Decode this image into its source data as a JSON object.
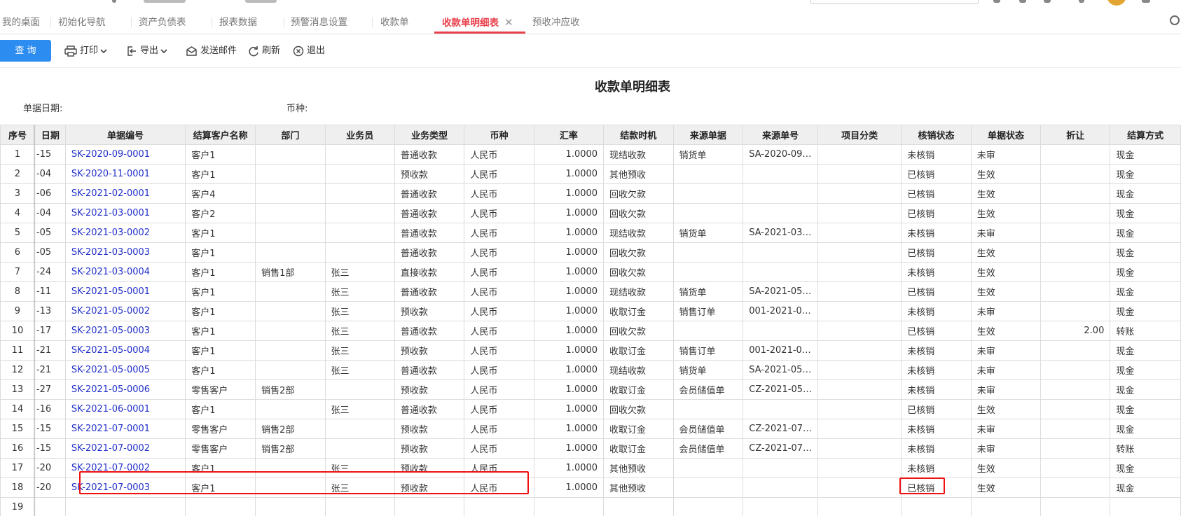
{
  "tabs": [
    {
      "label": "我的桌面",
      "active": false
    },
    {
      "label": "初始化导航",
      "active": false
    },
    {
      "label": "资产负债表",
      "active": false
    },
    {
      "label": "报表数据",
      "active": false
    },
    {
      "label": "预警消息设置",
      "active": false
    },
    {
      "label": "收款单",
      "active": false
    },
    {
      "label": "收款单明细表",
      "active": true
    },
    {
      "label": "预收冲应收",
      "active": false
    }
  ],
  "toolbar": {
    "query": "查 询",
    "print": "打印",
    "export": "导出",
    "send_mail": "发送邮件",
    "refresh": "刷新",
    "exit": "退出"
  },
  "report": {
    "title": "收款单明细表",
    "date_label": "单据日期:",
    "currency_label": "币种:"
  },
  "table": {
    "columns": [
      "序号",
      "日期",
      "单据编号",
      "结算客户名称",
      "部门",
      "业务员",
      "业务类型",
      "币种",
      "汇率",
      "结款时机",
      "来源单据",
      "来源单号",
      "项目分类",
      "核销状态",
      "单据状态",
      "折让",
      "结算方式"
    ],
    "rows": [
      [
        "1",
        "-15",
        "SK-2020-09-0001",
        "客户1",
        "",
        "",
        "普通收款",
        "人民币",
        "1.0000",
        "现结收款",
        "销货单",
        "SA-2020-09…",
        "",
        "未核销",
        "未审",
        "",
        "现金"
      ],
      [
        "2",
        "-04",
        "SK-2020-11-0001",
        "客户1",
        "",
        "",
        "预收款",
        "人民币",
        "1.0000",
        "其他预收",
        "",
        "",
        "",
        "已核销",
        "生效",
        "",
        "现金"
      ],
      [
        "3",
        "-06",
        "SK-2021-02-0001",
        "客户4",
        "",
        "",
        "普通收款",
        "人民币",
        "1.0000",
        "回收欠款",
        "",
        "",
        "",
        "已核销",
        "生效",
        "",
        "现金"
      ],
      [
        "4",
        "-04",
        "SK-2021-03-0001",
        "客户2",
        "",
        "",
        "普通收款",
        "人民币",
        "1.0000",
        "回收欠款",
        "",
        "",
        "",
        "已核销",
        "生效",
        "",
        "现金"
      ],
      [
        "5",
        "-05",
        "SK-2021-03-0002",
        "客户1",
        "",
        "",
        "普通收款",
        "人民币",
        "1.0000",
        "现结收款",
        "销货单",
        "SA-2021-03…",
        "",
        "未核销",
        "未审",
        "",
        "现金"
      ],
      [
        "6",
        "-05",
        "SK-2021-03-0003",
        "客户1",
        "",
        "",
        "普通收款",
        "人民币",
        "1.0000",
        "回收欠款",
        "",
        "",
        "",
        "已核销",
        "生效",
        "",
        "现金"
      ],
      [
        "7",
        "-24",
        "SK-2021-03-0004",
        "客户1",
        "销售1部",
        "张三",
        "直接收款",
        "人民币",
        "1.0000",
        "回收欠款",
        "",
        "",
        "",
        "未核销",
        "生效",
        "",
        "现金"
      ],
      [
        "8",
        "-11",
        "SK-2021-05-0001",
        "客户1",
        "",
        "张三",
        "普通收款",
        "人民币",
        "1.0000",
        "现结收款",
        "销货单",
        "SA-2021-05…",
        "",
        "已核销",
        "生效",
        "",
        "现金"
      ],
      [
        "9",
        "-13",
        "SK-2021-05-0002",
        "客户1",
        "",
        "张三",
        "预收款",
        "人民币",
        "1.0000",
        "收取订金",
        "销售订单",
        "001-2021-0…",
        "",
        "未核销",
        "未审",
        "",
        "现金"
      ],
      [
        "10",
        "-17",
        "SK-2021-05-0003",
        "客户1",
        "",
        "张三",
        "普通收款",
        "人民币",
        "1.0000",
        "回收欠款",
        "",
        "",
        "",
        "已核销",
        "生效",
        "2.00",
        "转账"
      ],
      [
        "11",
        "-21",
        "SK-2021-05-0004",
        "客户1",
        "",
        "张三",
        "预收款",
        "人民币",
        "1.0000",
        "收取订金",
        "销售订单",
        "001-2021-0…",
        "",
        "未核销",
        "未审",
        "",
        "现金"
      ],
      [
        "12",
        "-21",
        "SK-2021-05-0005",
        "客户1",
        "",
        "张三",
        "普通收款",
        "人民币",
        "1.0000",
        "现结收款",
        "销货单",
        "SA-2021-05…",
        "",
        "未核销",
        "未审",
        "",
        "现金"
      ],
      [
        "13",
        "-27",
        "SK-2021-05-0006",
        "零售客户",
        "销售2部",
        "",
        "预收款",
        "人民币",
        "1.0000",
        "收取订金",
        "会员储值单",
        "CZ-2021-05…",
        "",
        "未核销",
        "未审",
        "",
        "现金"
      ],
      [
        "14",
        "-16",
        "SK-2021-06-0001",
        "客户1",
        "",
        "张三",
        "普通收款",
        "人民币",
        "1.0000",
        "回收欠款",
        "",
        "",
        "",
        "已核销",
        "生效",
        "",
        "现金"
      ],
      [
        "15",
        "-15",
        "SK-2021-07-0001",
        "零售客户",
        "销售2部",
        "",
        "预收款",
        "人民币",
        "1.0000",
        "收取订金",
        "会员储值单",
        "CZ-2021-07…",
        "",
        "未核销",
        "未审",
        "",
        "现金"
      ],
      [
        "16",
        "-15",
        "SK-2021-07-0002",
        "零售客户",
        "销售2部",
        "",
        "预收款",
        "人民币",
        "1.0000",
        "收取订金",
        "会员储值单",
        "CZ-2021-07…",
        "",
        "未核销",
        "未审",
        "",
        "转账"
      ],
      [
        "17",
        "-20",
        "SK-2021-07-0002",
        "客户1",
        "",
        "张三",
        "预收款",
        "人民币",
        "1.0000",
        "其他预收",
        "",
        "",
        "",
        "未核销",
        "生效",
        "",
        "现金"
      ],
      [
        "18",
        "-20",
        "SK-2021-07-0003",
        "客户1",
        "",
        "张三",
        "预收款",
        "人民币",
        "1.0000",
        "其他预收",
        "",
        "",
        "",
        "已核销",
        "生效",
        "",
        "现金"
      ],
      [
        "19",
        "",
        "",
        "",
        "",
        "",
        "",
        "",
        "",
        "",
        "",
        "",
        "",
        "",
        "",
        "",
        ""
      ]
    ]
  }
}
